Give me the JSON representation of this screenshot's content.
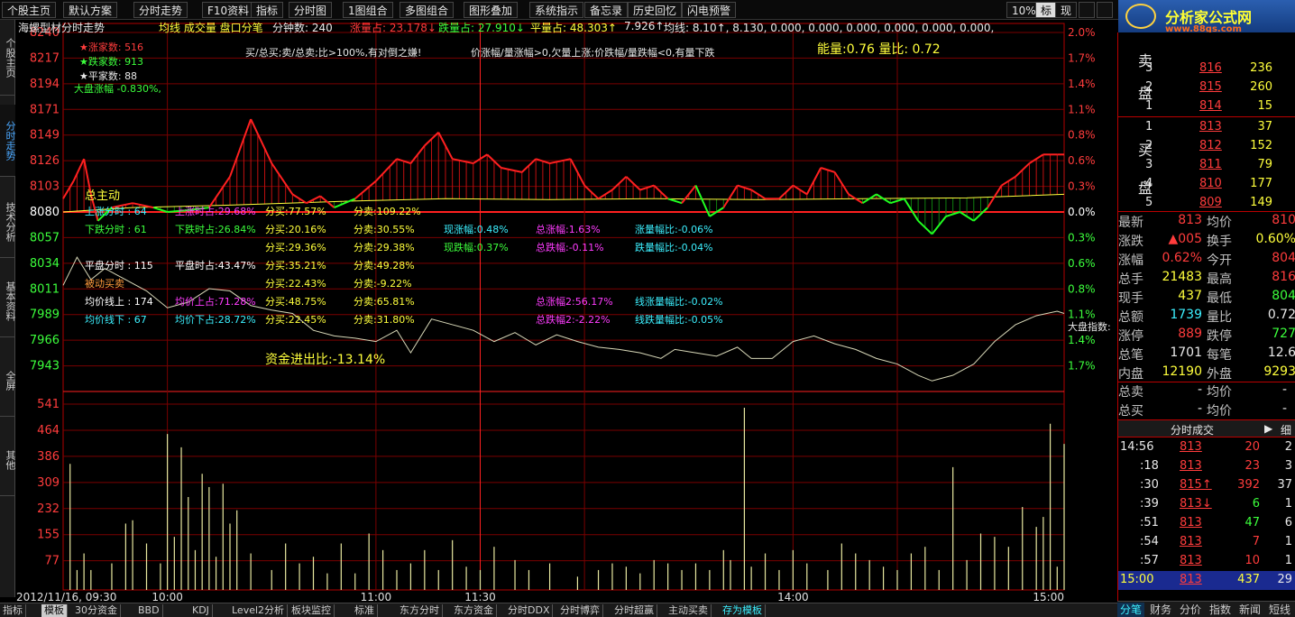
{
  "toolbar": {
    "items": [
      "个股主页",
      "默认方案",
      "分时走势",
      "F10资料",
      "指标",
      "分时图",
      "1图组合",
      "多图组合",
      "图形叠加",
      "系统指示",
      "备忘录",
      "历史回忆",
      "闪电预警"
    ],
    "right_items": [
      "10%",
      "标",
      "现"
    ]
  },
  "logo": {
    "line1": "分析家公式网",
    "line2": "www.88gs.com"
  },
  "left_tabs": [
    "个股主页",
    "分时走势",
    "技术分析",
    "基本资料",
    "全屏",
    "其他"
  ],
  "info_bar": {
    "title": "海螺型材分时走势",
    "legend": "均线 成交量 盘口分笔",
    "minutes_label": "分钟数: 240",
    "rise_ratio": "涨量占: 23.178↓",
    "fall_ratio": "跌量占: 27.910↓",
    "flat_ratio": "平量占: 48.303↑",
    "v1": "7.926↑",
    "ma_line": "均线: 8.10↑, 8.130, 0.000, 0.000, 0.000, 0.000, 0.000, 0.000,"
  },
  "stats": {
    "up_count": "★涨家数: 516",
    "down_count": "★跌家数: 913",
    "flat_count": "★平家数: 88",
    "index_change": "大盘涨幅 -0.830%,",
    "buy_sell_note": "买/总买;卖/总卖;比>100%,有对倒之嫌!",
    "price_volume_note": "价涨幅/量涨幅>0,欠量上涨;价跌幅/量跌幅<0,有量下跌",
    "energy": "能量:0.76 量比: 0.72",
    "main_force": "总主动",
    "fund_flow": "资金进出比:-13.14%",
    "index_label": "大盘指数:"
  },
  "analysis_rows": [
    {
      "c": "#3cf0ff",
      "t": "上涨分时 :  64"
    },
    {
      "c": "#ff3cff",
      "t": "上涨时占:29.68%"
    },
    {
      "c": "#ffff3c",
      "t": "分买:77.57%"
    },
    {
      "c": "#ffff3c",
      "t": "分卖:109.22%"
    }
  ],
  "grid_rows": [
    [
      "下跌分时 :  61",
      "下跌时占:26.84%",
      "分买:20.16%",
      "分卖:30.55%",
      "现涨幅:0.48%",
      "总涨幅:1.63%",
      "涨量幅比:-0.06%"
    ],
    [
      "",
      "",
      "分买:29.36%",
      "分卖:29.38%",
      "现跌幅:0.37%",
      "总跌幅:-0.11%",
      "跌量幅比:-0.04%"
    ],
    [
      "平盘分时 :  115",
      "平盘时占:43.47%",
      "分买:35.21%",
      "分卖:49.28%",
      "",
      "",
      ""
    ],
    [
      "被动买卖",
      "",
      "分买:22.43%",
      "分卖:-9.22%",
      "",
      "",
      ""
    ],
    [
      "均价线上 :  174",
      "均价上占:71.28%",
      "分买:48.75%",
      "分卖:65.81%",
      "",
      "总涨幅2:56.17%",
      "线涨量幅比:-0.02%"
    ],
    [
      "均价线下 :  67",
      "均价下占:28.72%",
      "分买:22.45%",
      "分卖:31.80%",
      "",
      "总跌幅2:-2.22%",
      "线跌量幅比:-0.05%"
    ]
  ],
  "chart_data": {
    "type": "line",
    "price_axis": [
      "8240",
      "8217",
      "8194",
      "8171",
      "8149",
      "8126",
      "8103",
      "8080",
      "8057",
      "8034",
      "8011",
      "7989",
      "7966",
      "7943"
    ],
    "pct_axis": [
      "2.0%",
      "1.7%",
      "1.4%",
      "1.1%",
      "0.8%",
      "0.6%",
      "0.3%",
      "0.0%",
      "0.3%",
      "0.6%",
      "0.8%",
      "1.1%",
      "1.4%",
      "1.7%"
    ],
    "volume_axis": [
      "541",
      "464",
      "386",
      "309",
      "232",
      "155",
      "77"
    ],
    "time_labels": [
      "2012/11/16, 09:30",
      "10:00",
      "11:00",
      "11:30",
      "14:00",
      "15:00"
    ],
    "price_series": [
      [
        0,
        0.15
      ],
      [
        3,
        0.35
      ],
      [
        6,
        0.6
      ],
      [
        8,
        0.2
      ],
      [
        10,
        -0.1
      ],
      [
        14,
        0.05
      ],
      [
        20,
        0.1
      ],
      [
        26,
        0.05
      ],
      [
        30,
        0.0
      ],
      [
        36,
        0.02
      ],
      [
        42,
        0.05
      ],
      [
        48,
        0.4
      ],
      [
        54,
        1.05
      ],
      [
        60,
        0.55
      ],
      [
        66,
        0.2
      ],
      [
        70,
        0.1
      ],
      [
        74,
        0.18
      ],
      [
        78,
        0.05
      ],
      [
        84,
        0.15
      ],
      [
        90,
        0.35
      ],
      [
        96,
        0.6
      ],
      [
        100,
        0.55
      ],
      [
        104,
        0.75
      ],
      [
        108,
        0.9
      ],
      [
        112,
        0.6
      ],
      [
        118,
        0.55
      ],
      [
        122,
        0.65
      ],
      [
        126,
        0.5
      ],
      [
        132,
        0.45
      ],
      [
        136,
        0.6
      ],
      [
        140,
        0.55
      ],
      [
        146,
        0.6
      ],
      [
        150,
        0.3
      ],
      [
        154,
        0.15
      ],
      [
        158,
        0.25
      ],
      [
        162,
        0.4
      ],
      [
        166,
        0.25
      ],
      [
        170,
        0.3
      ],
      [
        174,
        0.15
      ],
      [
        178,
        0.1
      ],
      [
        182,
        0.3
      ],
      [
        186,
        -0.05
      ],
      [
        190,
        0.05
      ],
      [
        194,
        0.3
      ],
      [
        198,
        0.25
      ],
      [
        202,
        0.15
      ],
      [
        206,
        0.15
      ],
      [
        210,
        0.3
      ],
      [
        214,
        0.2
      ],
      [
        218,
        0.5
      ],
      [
        222,
        0.45
      ],
      [
        226,
        0.2
      ],
      [
        230,
        0.1
      ],
      [
        234,
        0.2
      ],
      [
        238,
        0.1
      ],
      [
        242,
        0.15
      ],
      [
        246,
        -0.1
      ],
      [
        250,
        -0.25
      ],
      [
        254,
        -0.05
      ],
      [
        258,
        0.0
      ],
      [
        262,
        -0.1
      ],
      [
        266,
        0.05
      ],
      [
        270,
        0.3
      ],
      [
        274,
        0.4
      ],
      [
        278,
        0.55
      ],
      [
        282,
        0.65
      ],
      [
        286,
        0.65
      ],
      [
        288,
        0.65
      ]
    ],
    "avg_series": [
      [
        0,
        0.0
      ],
      [
        20,
        0.05
      ],
      [
        50,
        0.08
      ],
      [
        80,
        0.12
      ],
      [
        110,
        0.15
      ],
      [
        140,
        0.14
      ],
      [
        170,
        0.15
      ],
      [
        200,
        0.14
      ],
      [
        230,
        0.15
      ],
      [
        260,
        0.16
      ],
      [
        288,
        0.2
      ]
    ],
    "index_series": [
      [
        0,
        8015
      ],
      [
        4,
        8040
      ],
      [
        8,
        8020
      ],
      [
        12,
        8030
      ],
      [
        18,
        8020
      ],
      [
        24,
        8010
      ],
      [
        30,
        7995
      ],
      [
        36,
        8000
      ],
      [
        42,
        8012
      ],
      [
        48,
        8010
      ],
      [
        54,
        7997
      ],
      [
        60,
        7993
      ],
      [
        66,
        7990
      ],
      [
        72,
        7975
      ],
      [
        78,
        7970
      ],
      [
        84,
        7968
      ],
      [
        90,
        7965
      ],
      [
        96,
        7975
      ],
      [
        100,
        7955
      ],
      [
        106,
        7985
      ],
      [
        112,
        7980
      ],
      [
        118,
        7975
      ],
      [
        124,
        7965
      ],
      [
        130,
        7973
      ],
      [
        136,
        7962
      ],
      [
        142,
        7971
      ],
      [
        148,
        7965
      ],
      [
        154,
        7960
      ],
      [
        160,
        7958
      ],
      [
        166,
        7955
      ],
      [
        172,
        7950
      ],
      [
        176,
        7958
      ],
      [
        182,
        7955
      ],
      [
        188,
        7952
      ],
      [
        194,
        7960
      ],
      [
        198,
        7950
      ],
      [
        204,
        7950
      ],
      [
        210,
        7965
      ],
      [
        216,
        7970
      ],
      [
        222,
        7963
      ],
      [
        228,
        7958
      ],
      [
        234,
        7950
      ],
      [
        240,
        7945
      ],
      [
        246,
        7935
      ],
      [
        250,
        7930
      ],
      [
        256,
        7935
      ],
      [
        262,
        7945
      ],
      [
        268,
        7965
      ],
      [
        274,
        7980
      ],
      [
        280,
        7988
      ],
      [
        286,
        7992
      ],
      [
        288,
        7990
      ]
    ],
    "volume_series": [
      [
        2,
        380
      ],
      [
        4,
        60
      ],
      [
        6,
        110
      ],
      [
        8,
        60
      ],
      [
        14,
        80
      ],
      [
        18,
        200
      ],
      [
        20,
        210
      ],
      [
        24,
        140
      ],
      [
        28,
        80
      ],
      [
        30,
        470
      ],
      [
        32,
        160
      ],
      [
        34,
        430
      ],
      [
        36,
        280
      ],
      [
        38,
        120
      ],
      [
        40,
        350
      ],
      [
        42,
        310
      ],
      [
        44,
        100
      ],
      [
        46,
        320
      ],
      [
        48,
        200
      ],
      [
        50,
        240
      ],
      [
        54,
        110
      ],
      [
        60,
        60
      ],
      [
        64,
        140
      ],
      [
        68,
        80
      ],
      [
        72,
        100
      ],
      [
        76,
        50
      ],
      [
        80,
        140
      ],
      [
        84,
        50
      ],
      [
        88,
        170
      ],
      [
        92,
        120
      ],
      [
        96,
        60
      ],
      [
        100,
        80
      ],
      [
        104,
        120
      ],
      [
        108,
        60
      ],
      [
        112,
        150
      ],
      [
        116,
        70
      ],
      [
        120,
        60
      ],
      [
        124,
        130
      ],
      [
        130,
        90
      ],
      [
        134,
        60
      ],
      [
        140,
        80
      ],
      [
        148,
        40
      ],
      [
        154,
        60
      ],
      [
        158,
        80
      ],
      [
        162,
        70
      ],
      [
        166,
        50
      ],
      [
        170,
        90
      ],
      [
        174,
        80
      ],
      [
        178,
        60
      ],
      [
        182,
        80
      ],
      [
        186,
        60
      ],
      [
        190,
        120
      ],
      [
        192,
        90
      ],
      [
        196,
        549
      ],
      [
        198,
        70
      ],
      [
        202,
        110
      ],
      [
        206,
        60
      ],
      [
        210,
        120
      ],
      [
        214,
        80
      ],
      [
        220,
        60
      ],
      [
        224,
        140
      ],
      [
        228,
        110
      ],
      [
        232,
        90
      ],
      [
        236,
        70
      ],
      [
        240,
        60
      ],
      [
        244,
        110
      ],
      [
        248,
        130
      ],
      [
        252,
        60
      ],
      [
        256,
        370
      ],
      [
        260,
        90
      ],
      [
        264,
        170
      ],
      [
        268,
        160
      ],
      [
        272,
        130
      ],
      [
        276,
        250
      ],
      [
        280,
        190
      ],
      [
        282,
        220
      ],
      [
        284,
        501
      ],
      [
        286,
        70
      ],
      [
        288,
        440
      ]
    ],
    "price_range": [
      -0.9,
      2.0
    ],
    "volume_max": 580
  },
  "quote": {
    "asks_top": [
      [
        "3",
        "816",
        "236"
      ],
      [
        "2",
        "815",
        "260"
      ],
      [
        "1",
        "814",
        "15"
      ]
    ],
    "bids": [
      [
        "1",
        "813",
        "37"
      ],
      [
        "2",
        "812",
        "152"
      ],
      [
        "3",
        "811",
        "79"
      ],
      [
        "4",
        "810",
        "177"
      ],
      [
        "5",
        "809",
        "149"
      ]
    ],
    "sell_label": "卖\n盘",
    "buy_label": "买\n盘",
    "fields": [
      [
        "最新",
        "813",
        "均价",
        "810"
      ],
      [
        "涨跌",
        "▲005",
        "换手",
        "0.60%"
      ],
      [
        "涨幅",
        "0.62%",
        "今开",
        "804"
      ],
      [
        "总手",
        "21483",
        "最高",
        "816"
      ],
      [
        "现手",
        "437",
        "最低",
        "804"
      ],
      [
        "总额",
        "1739",
        "量比",
        "0.72"
      ],
      [
        "涨停",
        "889",
        "跌停",
        "727"
      ],
      [
        "总笔",
        "1701",
        "每笔",
        "12.6"
      ],
      [
        "内盘",
        "12190",
        "外盘",
        "9293"
      ]
    ],
    "total_sell": [
      "总卖",
      "-",
      "均价",
      "-"
    ],
    "total_buy": [
      "总买",
      "-",
      "均价",
      "-"
    ],
    "ticks_header": "分时成交",
    "ticks_detail": "细",
    "ticks": [
      [
        "14:56",
        "813",
        "20",
        "2"
      ],
      [
        ":18",
        "813",
        "23",
        "3"
      ],
      [
        ":30",
        "815↑",
        "392",
        "37"
      ],
      [
        ":39",
        "813↓",
        "6",
        "1"
      ],
      [
        ":51",
        "813",
        "47",
        "6"
      ],
      [
        ":54",
        "813",
        "7",
        "1"
      ],
      [
        ":57",
        "813",
        "10",
        "1"
      ],
      [
        "15:00",
        "813",
        "437",
        "29"
      ]
    ]
  },
  "bottom_tabs": [
    "指标",
    "模板",
    "30分资金",
    "BBD",
    "KDJ",
    "Level2分析",
    "板块监控",
    "标准",
    "东方分时",
    "东方资金",
    "分时DDX",
    "分时博弈",
    "分时超赢",
    "主动买卖",
    "存为模板"
  ],
  "panel_tabs": [
    "分笔",
    "财务",
    "分价",
    "指数",
    "新闻",
    "短线"
  ]
}
